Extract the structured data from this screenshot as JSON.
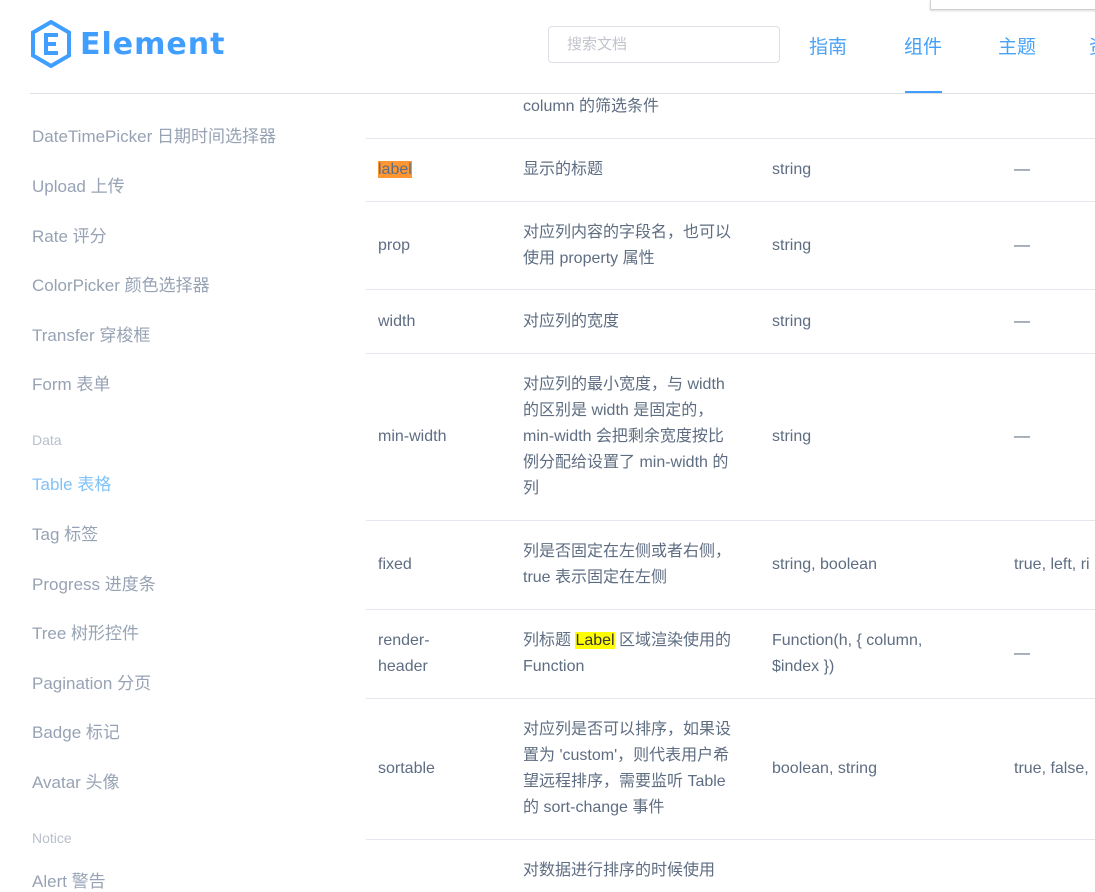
{
  "brand": {
    "name": "Element",
    "color": "#409eff"
  },
  "search": {
    "placeholder": "搜索文档"
  },
  "nav": {
    "items": [
      "指南",
      "组件",
      "主题",
      "资"
    ],
    "active": "组件"
  },
  "sidebar": {
    "items": [
      "DateTimePicker 日期时间选择器",
      "Upload 上传",
      "Rate 评分",
      "ColorPicker 颜色选择器",
      "Transfer 穿梭框",
      "Form 表单"
    ],
    "group_data": "Data",
    "data_items": [
      "Table 表格",
      "Tag 标签",
      "Progress 进度条",
      "Tree 树形控件",
      "Pagination 分页",
      "Badge 标记",
      "Avatar 头像"
    ],
    "active": "Table 表格",
    "group_notice": "Notice",
    "notice_items": [
      "Alert 警告"
    ]
  },
  "table": {
    "partial_top_desc": "column 的筛选条件",
    "rows": [
      {
        "name": "label",
        "desc": "显示的标题",
        "type": "string",
        "accepted": "—"
      },
      {
        "name": "prop",
        "desc": "对应列内容的字段名，也可以使用 property 属性",
        "type": "string",
        "accepted": "—"
      },
      {
        "name": "width",
        "desc": "对应列的宽度",
        "type": "string",
        "accepted": "—"
      },
      {
        "name": "min-width",
        "desc": "对应列的最小宽度，与 width 的区别是 width 是固定的，min-width 会把剩余宽度按比例分配给设置了 min-width 的列",
        "type": "string",
        "accepted": "—"
      },
      {
        "name": "fixed",
        "desc": "列是否固定在左侧或者右侧，true 表示固定在左侧",
        "type": "string, boolean",
        "accepted": "true, left, ri"
      },
      {
        "name": "render-header",
        "desc_before": "列标题 ",
        "desc_highlight": "Label",
        "desc_after": " 区域渲染使用的 Function",
        "type": "Function(h, { column, $index })",
        "accepted": "—"
      },
      {
        "name": "sortable",
        "desc": "对应列是否可以排序，如果设置为 'custom'，则代表用户希望远程排序，需要监听 Table 的 sort-change 事件",
        "type": "boolean, string",
        "accepted": "true, false,"
      }
    ],
    "partial_bottom_desc": "对数据进行排序的时候使用"
  }
}
